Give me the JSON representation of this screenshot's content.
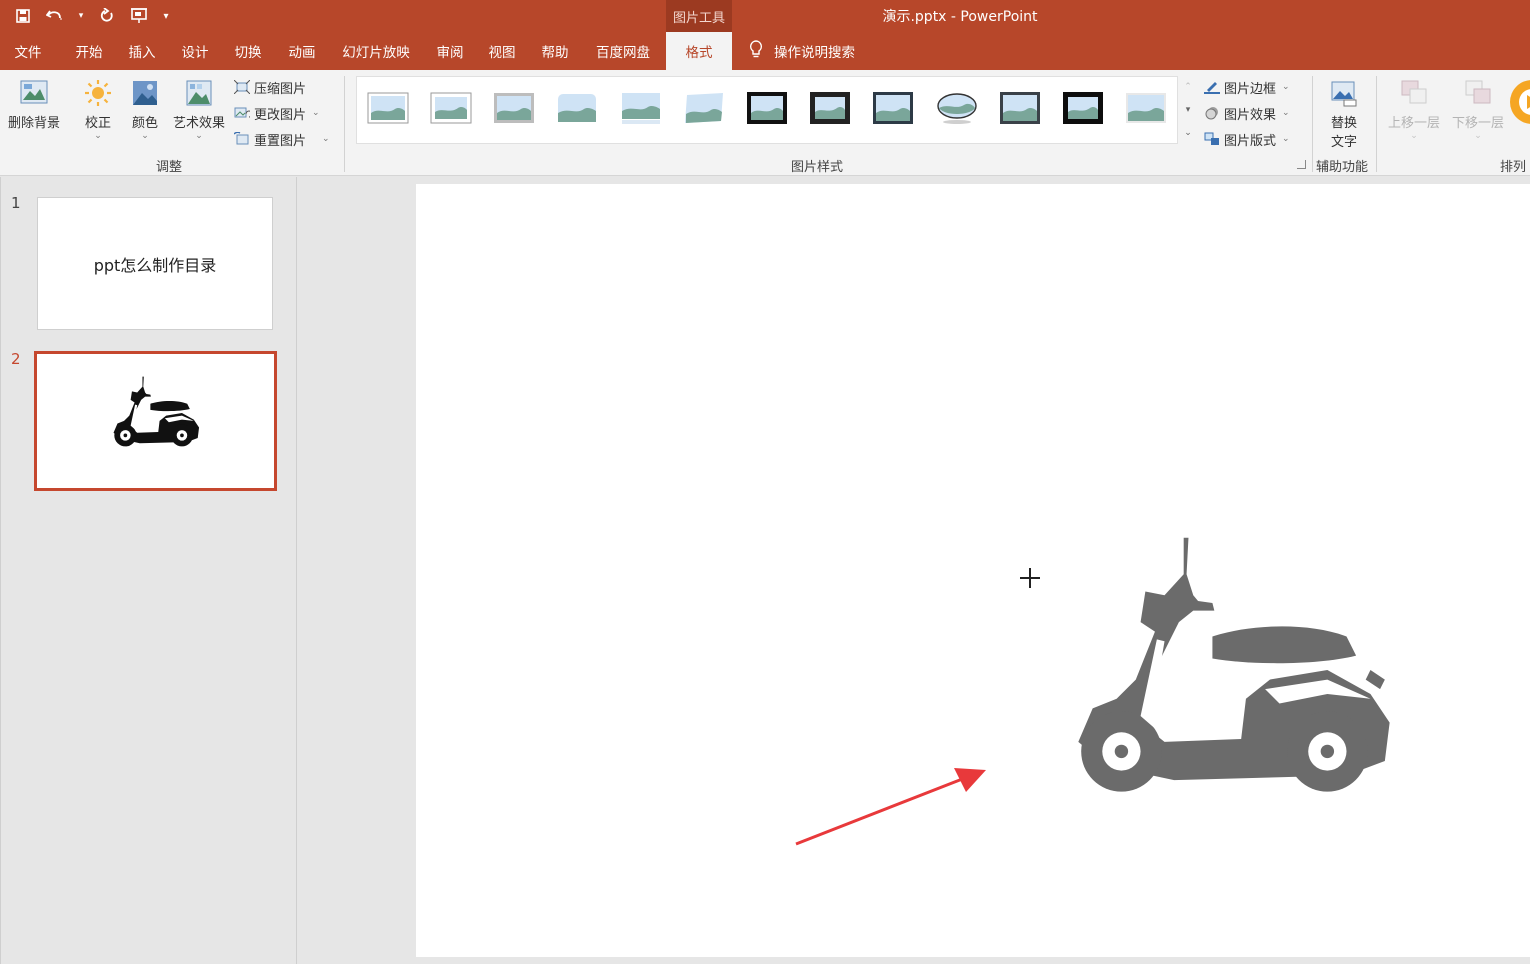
{
  "titlebar": {
    "context_group": "图片工具",
    "doc_title": "演示.pptx  -  PowerPoint"
  },
  "tabs": [
    {
      "label": "文件"
    },
    {
      "label": "开始"
    },
    {
      "label": "插入"
    },
    {
      "label": "设计"
    },
    {
      "label": "切换"
    },
    {
      "label": "动画"
    },
    {
      "label": "幻灯片放映"
    },
    {
      "label": "审阅"
    },
    {
      "label": "视图"
    },
    {
      "label": "帮助"
    },
    {
      "label": "百度网盘"
    },
    {
      "label": "格式",
      "active": true
    }
  ],
  "tell_me": "操作说明搜索",
  "ribbon": {
    "adjust": {
      "remove_bg": "删除背景",
      "corrections": "校正",
      "color": "颜色",
      "artistic": "艺术效果",
      "compress": "压缩图片",
      "change": "更改图片",
      "reset": "重置图片",
      "group_label": "调整"
    },
    "styles": {
      "group_label": "图片样式",
      "border": "图片边框",
      "effects": "图片效果",
      "layout": "图片版式",
      "thumb_count": 13
    },
    "accessibility": {
      "alt_text_line1": "替换",
      "alt_text_line2": "文字",
      "group_label": "辅助功能"
    },
    "arrange": {
      "bring_forward": "上移一层",
      "send_backward": "下移一层",
      "group_label": "排列"
    }
  },
  "slides": [
    {
      "number": "1",
      "text": "ppt怎么制作目录"
    },
    {
      "number": "2",
      "selected": true
    }
  ],
  "colors": {
    "accent": "#b7472a",
    "scooter_main": "#6b6b6b",
    "scooter_thumb": "#111111",
    "arrow": "#e8393b"
  }
}
